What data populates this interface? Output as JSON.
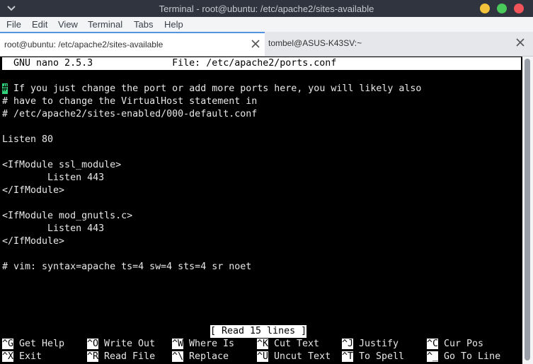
{
  "window": {
    "title": "Terminal - root@ubuntu: /etc/apache2/sites-available"
  },
  "menu": [
    "File",
    "Edit",
    "View",
    "Terminal",
    "Tabs",
    "Help"
  ],
  "tabs": [
    {
      "label": "root@ubuntu: /etc/apache2/sites-available",
      "active": true
    },
    {
      "label": "tombel@ASUS-K43SV:~",
      "active": false
    }
  ],
  "nano": {
    "header": "  GNU nano 2.5.3              File: /etc/apache2/ports.conf",
    "cursor_char": "#",
    "first_line_rest": " If you just change the port or add more ports here, you will likely also",
    "lines": [
      "# have to change the VirtualHost statement in",
      "# /etc/apache2/sites-enabled/000-default.conf",
      "",
      "Listen 80",
      "",
      "<IfModule ssl_module>",
      "        Listen 443",
      "</IfModule>",
      "",
      "<IfModule mod_gnutls.c>",
      "        Listen 443",
      "</IfModule>",
      "",
      "# vim: syntax=apache ts=4 sw=4 sts=4 sr noet"
    ],
    "status": "[ Read 15 lines ]",
    "shortcuts_row1": [
      {
        "key": "^G",
        "label": " Get Help"
      },
      {
        "key": "^O",
        "label": " Write Out"
      },
      {
        "key": "^W",
        "label": " Where Is"
      },
      {
        "key": "^K",
        "label": " Cut Text"
      },
      {
        "key": "^J",
        "label": " Justify"
      },
      {
        "key": "^C",
        "label": " Cur Pos"
      }
    ],
    "shortcuts_row2": [
      {
        "key": "^X",
        "label": " Exit"
      },
      {
        "key": "^R",
        "label": " Read File"
      },
      {
        "key": "^\\",
        "label": " Replace"
      },
      {
        "key": "^U",
        "label": " Uncut Text"
      },
      {
        "key": "^T",
        "label": " To Spell"
      },
      {
        "key": "^_",
        "label": " Go To Line"
      }
    ]
  }
}
